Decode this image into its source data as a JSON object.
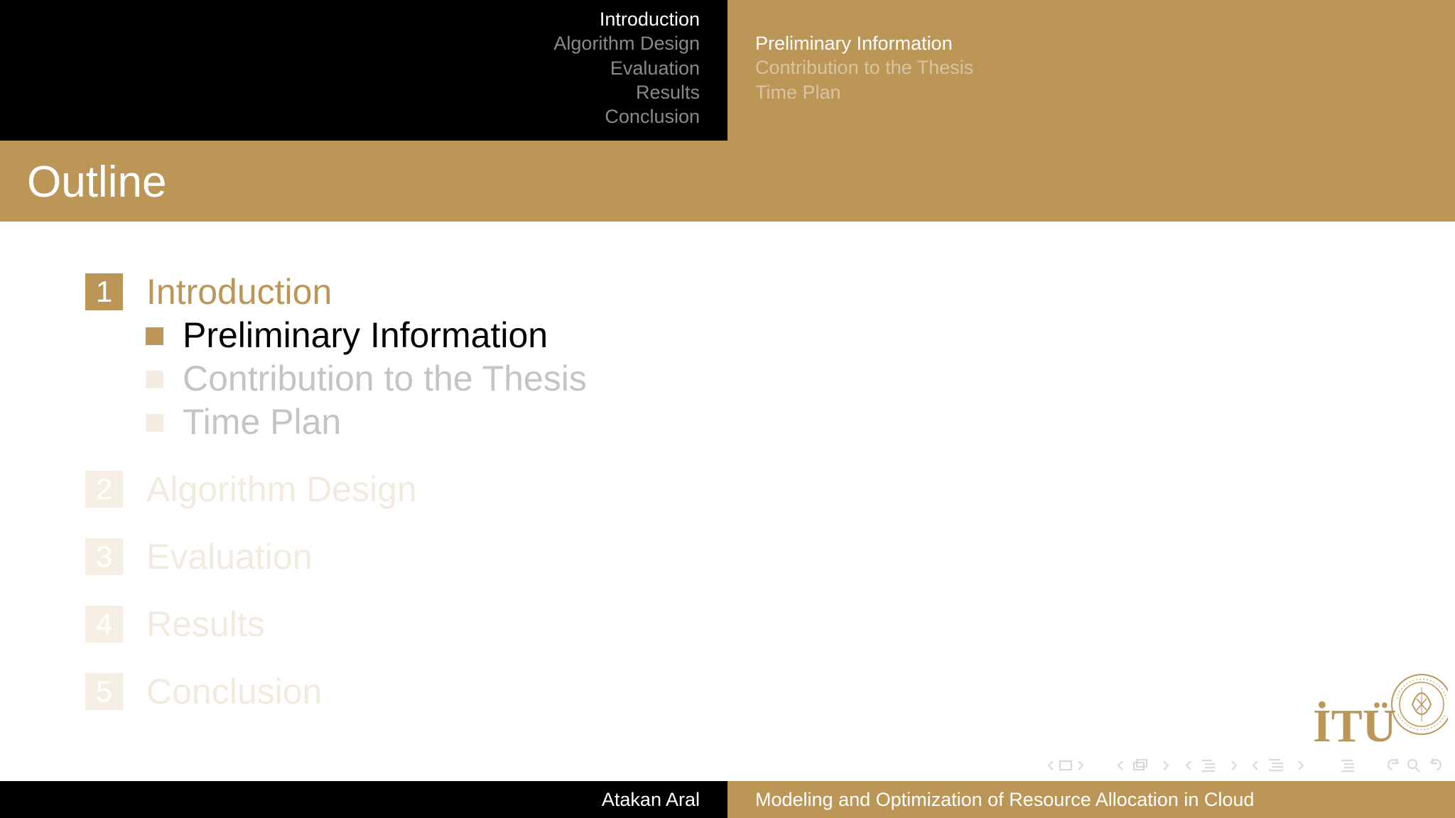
{
  "header": {
    "sections": [
      {
        "label": "Introduction",
        "current": true
      },
      {
        "label": "Algorithm Design",
        "current": false
      },
      {
        "label": "Evaluation",
        "current": false
      },
      {
        "label": "Results",
        "current": false
      },
      {
        "label": "Conclusion",
        "current": false
      }
    ],
    "subsections": [
      {
        "label": "Preliminary Information",
        "current": true
      },
      {
        "label": "Contribution to the Thesis",
        "current": false
      },
      {
        "label": "Time Plan",
        "current": false
      }
    ]
  },
  "frame": {
    "title": "Outline"
  },
  "outline": {
    "sections": [
      {
        "number": "1",
        "title": "Introduction",
        "active": true,
        "subsections": [
          {
            "title": "Preliminary Information",
            "active": true
          },
          {
            "title": "Contribution to the Thesis",
            "active": false
          },
          {
            "title": "Time Plan",
            "active": false
          }
        ]
      },
      {
        "number": "2",
        "title": "Algorithm Design",
        "active": false
      },
      {
        "number": "3",
        "title": "Evaluation",
        "active": false
      },
      {
        "number": "4",
        "title": "Results",
        "active": false
      },
      {
        "number": "5",
        "title": "Conclusion",
        "active": false
      }
    ]
  },
  "logo": {
    "text": "İTÜ",
    "seal_text": "İSTANBUL TEKNİK ÜNİVERSİTESİ",
    "seal_year": "1773"
  },
  "footer": {
    "author": "Atakan Aral",
    "title": "Modeling and Optimization of Resource Allocation in Cloud"
  },
  "colors": {
    "accent": "#bb9657",
    "header_dark": "#000000",
    "inactive_nav": "#8a8a8a",
    "faded_text": "#c4c4c4",
    "faded_accent": "#f1eadf",
    "nav_symbols": "#d9d9d9"
  }
}
